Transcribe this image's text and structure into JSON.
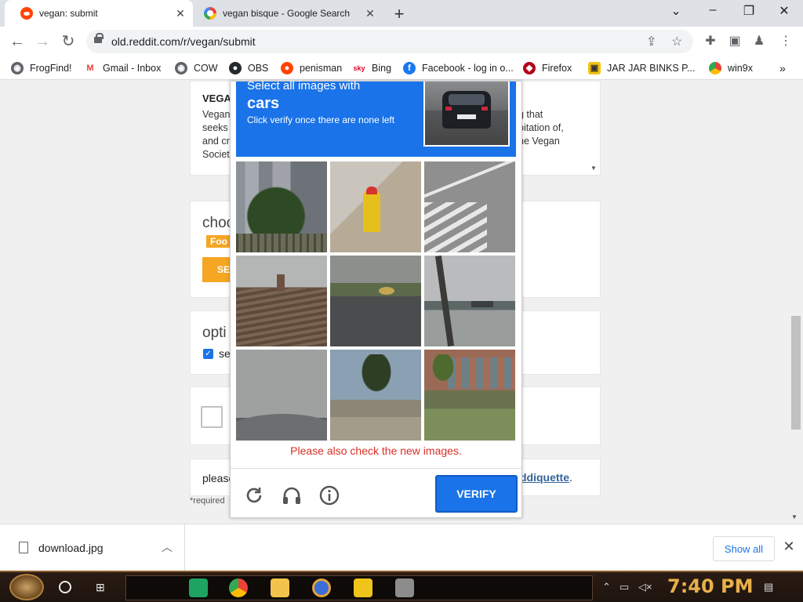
{
  "browser": {
    "tabs": [
      {
        "title": "vegan: submit",
        "active": true
      },
      {
        "title": "vegan bisque - Google Search",
        "active": false
      }
    ],
    "url": "old.reddit.com/r/vegan/submit",
    "bookmarks": [
      "FrogFind!",
      "Gmail - Inbox",
      "COW",
      "OBS",
      "penisman",
      "Bing",
      "Facebook - log in o...",
      "Firefox",
      "JAR JAR BINKS P...",
      "win9x"
    ],
    "overflow_label": "»"
  },
  "page": {
    "sidebar_heading": "VEGA",
    "sidebar_left_lines": [
      "Vegan",
      "seeks",
      "and cr",
      "Societ"
    ],
    "sidebar_right_lines": [
      "g that",
      "bitation of,",
      "he Vegan"
    ],
    "flair_heading": "choo",
    "flair_tag": "Foo",
    "flair_button": "SE",
    "options_heading": "opti",
    "options_checkbox_label": "se",
    "footer_text": "please",
    "footer_link": "ddiquette",
    "footer_period": ".",
    "required_note": "*required"
  },
  "captcha": {
    "prompt": "Select all images with",
    "object": "cars",
    "hint": "Click verify once there are none left",
    "error": "Please also check the new images.",
    "verify_label": "VERIFY",
    "tiles": [
      "building-with-tree",
      "fire-hydrant",
      "crosswalk",
      "rooftop-chimney",
      "road-with-birds",
      "waterfront-crane",
      "cloudy-sky",
      "house-with-palms",
      "building-with-palms"
    ],
    "colors": {
      "header": "#1a73e8",
      "error": "#d93025"
    }
  },
  "download": {
    "filename": "download.jpg",
    "show_all": "Show all"
  },
  "taskbar": {
    "time": "7:40 PM"
  }
}
